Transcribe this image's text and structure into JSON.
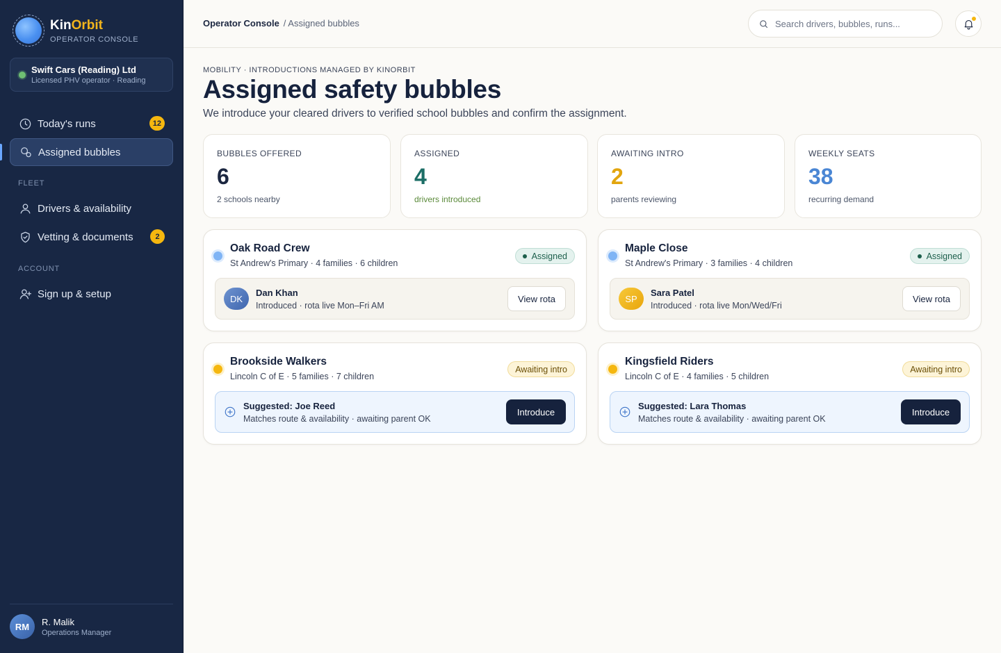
{
  "brand": {
    "name_main": "Kin",
    "name_accent": "Orbit",
    "subtitle": "OPERATOR CONSOLE"
  },
  "org": {
    "name": "Swift Cars (Reading) Ltd",
    "sub": "Licensed PHV operator · Reading"
  },
  "nav": {
    "todays_runs": {
      "label": "Today's runs",
      "badge": "12"
    },
    "assigned_bubbles": {
      "label": "Assigned bubbles"
    },
    "section_fleet": "FLEET",
    "drivers": {
      "label": "Drivers & availability"
    },
    "vetting": {
      "label": "Vetting & documents",
      "badge": "2"
    },
    "section_account": "ACCOUNT",
    "signup": {
      "label": "Sign up & setup"
    }
  },
  "user": {
    "initials": "RM",
    "name": "R. Malik",
    "role": "Operations Manager"
  },
  "topbar": {
    "crumb_root": "Operator Console",
    "crumb_current": "/ Assigned bubbles",
    "search_placeholder": "Search drivers, bubbles, runs..."
  },
  "header": {
    "eyebrow": "MOBILITY · INTRODUCTIONS MANAGED BY KINORBIT",
    "title": "Assigned safety bubbles",
    "subtitle": "We introduce your cleared drivers to verified school bubbles and confirm the assignment."
  },
  "stats": [
    {
      "label": "BUBBLES OFFERED",
      "value": "6",
      "sub": "2 schools nearby",
      "value_color": "#1b2640",
      "sub_color": "#4c566a"
    },
    {
      "label": "ASSIGNED",
      "value": "4",
      "sub": "drivers introduced",
      "value_color": "#1c6e66",
      "sub_color": "#5b8a3a"
    },
    {
      "label": "AWAITING INTRO",
      "value": "2",
      "sub": "parents reviewing",
      "value_color": "#e2a50e",
      "sub_color": "#4c566a"
    },
    {
      "label": "WEEKLY SEATS",
      "value": "38",
      "sub": "recurring demand",
      "value_color": "#4a86d4",
      "sub_color": "#4c566a"
    }
  ],
  "bubbles": [
    {
      "name": "Oak Road Crew",
      "meta": "St Andrew's Primary · 4 families · 6 children",
      "status": "Assigned",
      "driver_initials": "DK",
      "driver_name": "Dan Khan",
      "driver_sub": "Introduced · rota live Mon–Fri AM",
      "action": "View rota"
    },
    {
      "name": "Maple Close",
      "meta": "St Andrew's Primary · 3 families · 4 children",
      "status": "Assigned",
      "driver_initials": "SP",
      "driver_name": "Sara Patel",
      "driver_sub": "Introduced · rota live Mon/Wed/Fri",
      "action": "View rota"
    },
    {
      "name": "Brookside Walkers",
      "meta": "Lincoln C of E · 5 families · 7 children",
      "status": "Awaiting intro",
      "suggest_title": "Suggested: Joe Reed",
      "suggest_sub": "Matches route & availability · awaiting parent OK",
      "action": "Introduce"
    },
    {
      "name": "Kingsfield Riders",
      "meta": "Lincoln C of E · 4 families · 5 children",
      "status": "Awaiting intro",
      "suggest_title": "Suggested: Lara Thomas",
      "suggest_sub": "Matches route & availability · awaiting parent OK",
      "action": "Introduce"
    }
  ],
  "colors": {
    "sidebar": "#182744",
    "accent": "#f2b51c",
    "dark_button": "#16223d",
    "background": "#fbfaf7"
  }
}
